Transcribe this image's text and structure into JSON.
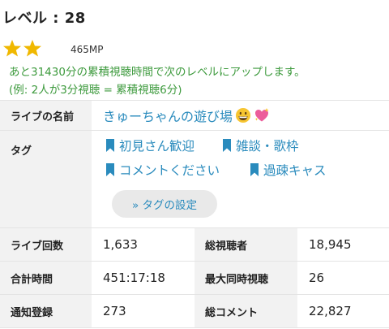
{
  "level": {
    "title": "レベル : 28"
  },
  "rating": {
    "stars": 2,
    "mp": "465MP",
    "star_color": "#f0b800"
  },
  "hint": {
    "line1": "あと31430分の累積視聴時間で次のレベルにアップします。",
    "line2": "(例: 2人が3分視聴 = 累積視聴6分)"
  },
  "stream": {
    "label": "ライブの名前",
    "name": "きゅーちゃんの遊び場",
    "emojis": [
      "grinning-face",
      "sparkling-heart"
    ]
  },
  "tags": {
    "label": "タグ",
    "items": [
      "初見さん歓迎",
      "雑談・歌枠",
      "コメントください",
      "過疎キャス"
    ],
    "settings_button": "» タグの設定"
  },
  "stats": [
    {
      "label1": "ライブ回数",
      "value1": "1,633",
      "label2": "総視聴者",
      "value2": "18,945"
    },
    {
      "label1": "合計時間",
      "value1": "451:17:18",
      "label2": "最大同時視聴",
      "value2": "26"
    },
    {
      "label1": "通知登録",
      "value1": "273",
      "label2": "総コメント",
      "value2": "22,827"
    }
  ],
  "colors": {
    "accent": "#2a8bbd",
    "hint": "#3d9a3d",
    "label_bg": "#f2f2f2"
  }
}
